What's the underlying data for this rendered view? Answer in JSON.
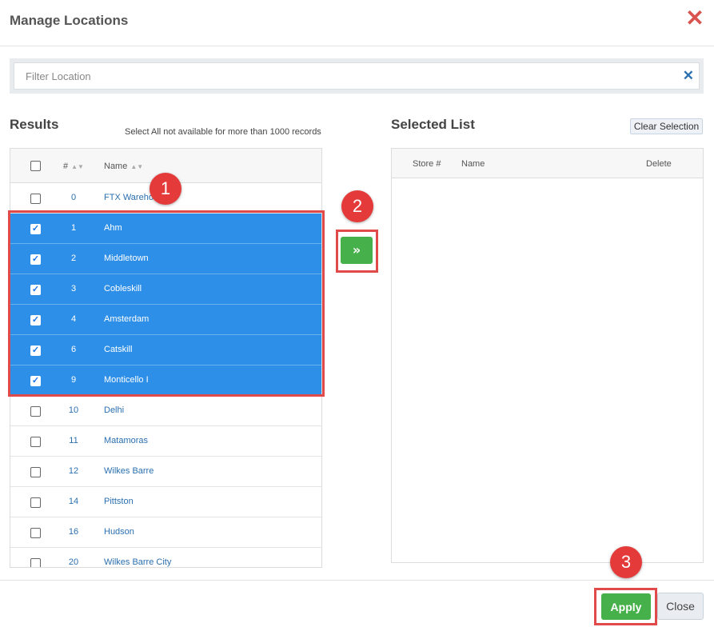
{
  "dialog": {
    "title": "Manage Locations",
    "close_icon": "close-icon"
  },
  "filter": {
    "placeholder": "Filter Location",
    "value": "",
    "clear_icon": "clear-icon"
  },
  "results": {
    "title": "Results",
    "note": "Select All not available for more than 1000 records",
    "columns": {
      "num": "#",
      "name": "Name"
    },
    "rows": [
      {
        "num": "0",
        "name": "FTX Warehouse",
        "checked": false
      },
      {
        "num": "1",
        "name": "Ahm",
        "checked": true
      },
      {
        "num": "2",
        "name": "Middletown",
        "checked": true
      },
      {
        "num": "3",
        "name": "Cobleskill",
        "checked": true
      },
      {
        "num": "4",
        "name": "Amsterdam",
        "checked": true
      },
      {
        "num": "6",
        "name": "Catskill",
        "checked": true
      },
      {
        "num": "9",
        "name": "Monticello I",
        "checked": true
      },
      {
        "num": "10",
        "name": "Delhi",
        "checked": false
      },
      {
        "num": "11",
        "name": "Matamoras",
        "checked": false
      },
      {
        "num": "12",
        "name": "Wilkes Barre",
        "checked": false
      },
      {
        "num": "14",
        "name": "Pittston",
        "checked": false
      },
      {
        "num": "16",
        "name": "Hudson",
        "checked": false
      },
      {
        "num": "20",
        "name": "Wilkes Barre City",
        "checked": false
      }
    ]
  },
  "move_button": {
    "label": "»",
    "icon": "double-chevron-right-icon"
  },
  "selected": {
    "title": "Selected List",
    "clear_label": "Clear Selection",
    "columns": {
      "store": "Store #",
      "name": "Name",
      "delete": "Delete"
    },
    "rows": []
  },
  "footer": {
    "apply_label": "Apply",
    "close_label": "Close"
  },
  "callouts": {
    "step1": "1",
    "step2": "2",
    "step3": "3"
  },
  "colors": {
    "selected_row": "#2e8fe8",
    "action_green": "#46b04a",
    "callout_red": "#e53a3a",
    "link_blue": "#2a6fb0"
  }
}
